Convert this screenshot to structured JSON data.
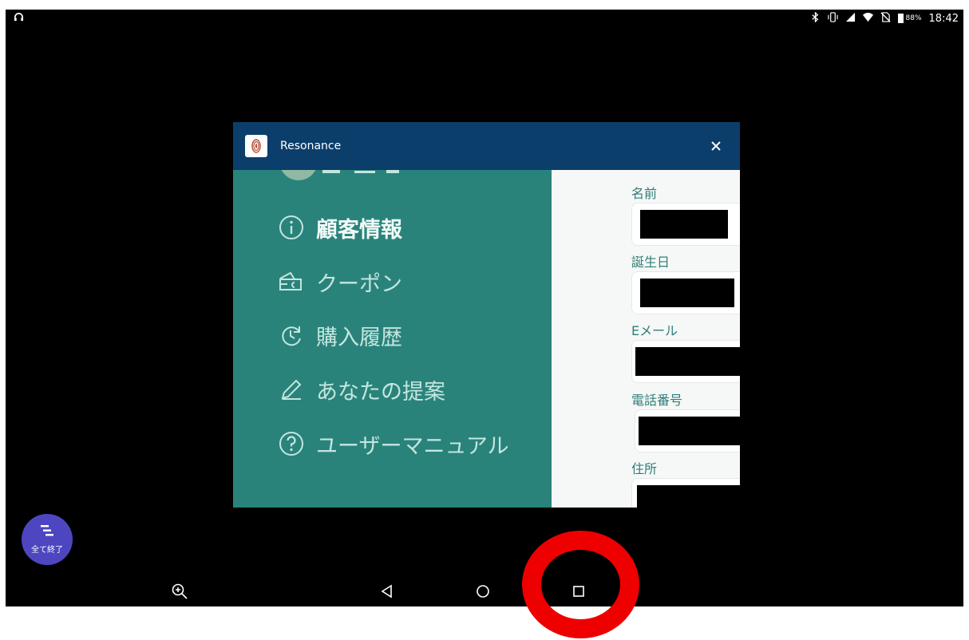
{
  "status_bar": {
    "battery_level": "88%",
    "time": "18:42",
    "icons": [
      "headphones-icon",
      "bluetooth-icon",
      "vibrate-icon",
      "signal-icon",
      "wifi-icon",
      "no-sim-icon",
      "battery-icon"
    ]
  },
  "window": {
    "title": "Resonance",
    "app_icon": "resonance-logo-icon",
    "close_icon": "close-icon"
  },
  "menu": {
    "items": [
      {
        "label": "顧客情報",
        "icon": "info-icon",
        "selected": true
      },
      {
        "label": "クーポン",
        "icon": "coupon-icon"
      },
      {
        "label": "購入履歴",
        "icon": "history-icon"
      },
      {
        "label": "あなたの提案",
        "icon": "pencil-icon"
      },
      {
        "label": "ユーザーマニュアル",
        "icon": "help-icon"
      }
    ]
  },
  "form": {
    "fields": [
      {
        "label": "名前",
        "value": "■■■■"
      },
      {
        "label": "誕生日",
        "value": "■■■■"
      },
      {
        "label": "Eメール",
        "value": "■■■■"
      },
      {
        "label": "電話番号",
        "value": "■■■■"
      },
      {
        "label": "住所",
        "value": "■■■■"
      }
    ]
  },
  "end_all_button": {
    "label": "全て終了",
    "icon": "clear-all-icon"
  },
  "nav_bar": {
    "icons": [
      "zoom-in-icon",
      "back-icon",
      "home-icon",
      "recents-icon"
    ]
  },
  "colors": {
    "titlebar": "#0c3e6b",
    "menu_bg": "#2a837b",
    "menu_text": "#c3e6df",
    "field_label": "#2f7f77",
    "end_all_bg": "#4e46c0",
    "annotation": "#ee0000"
  }
}
